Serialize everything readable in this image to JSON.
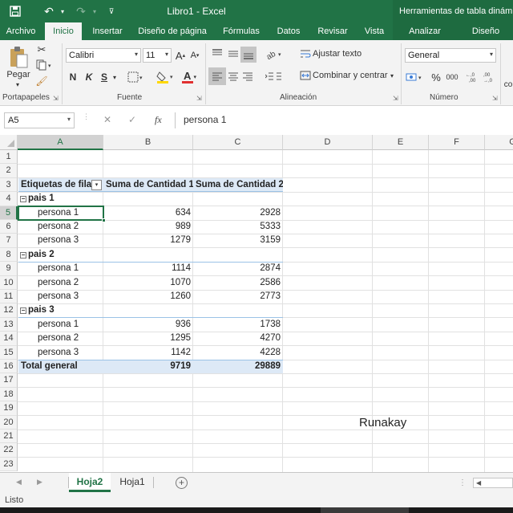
{
  "window": {
    "title": "Libro1 - Excel",
    "context_title": "Herramientas de tabla dinámica"
  },
  "tabs": [
    {
      "label": "Archivo"
    },
    {
      "label": "Inicio"
    },
    {
      "label": "Insertar"
    },
    {
      "label": "Diseño de página"
    },
    {
      "label": "Fórmulas"
    },
    {
      "label": "Datos"
    },
    {
      "label": "Revisar"
    },
    {
      "label": "Vista"
    },
    {
      "label": "Analizar"
    },
    {
      "label": "Diseño"
    }
  ],
  "ribbon": {
    "clipboard": {
      "paste_label": "Pegar",
      "group_label": "Portapapeles"
    },
    "font": {
      "name": "Calibri",
      "size": "11",
      "group_label": "Fuente",
      "bold": "N",
      "italic": "K",
      "underline": "S",
      "grow": "A",
      "shrink": "A",
      "font_color": "A",
      "font_color_hex": "#e03030",
      "fill_color_hex": "#ffd800"
    },
    "alignment": {
      "wrap_label": "Ajustar texto",
      "merge_label": "Combinar y centrar",
      "group_label": "Alineación"
    },
    "number": {
      "format": "General",
      "group_label": "Número",
      "percent": "%",
      "thousands": "000"
    },
    "cut_off_label": "co"
  },
  "formula_bar": {
    "name_box": "A5",
    "cancel": "✕",
    "enter": "✓",
    "fx": "fx",
    "value": "persona 1"
  },
  "columns": [
    "A",
    "B",
    "C",
    "D",
    "E",
    "F",
    "G"
  ],
  "rows": [
    "1",
    "2",
    "3",
    "4",
    "5",
    "6",
    "7",
    "8",
    "9",
    "10",
    "11",
    "12",
    "13",
    "14",
    "15",
    "16",
    "17",
    "18",
    "19",
    "20",
    "21",
    "22",
    "23"
  ],
  "pivot": {
    "headers": [
      "Etiquetas de fila",
      "Suma de Cantidad 1",
      "Suma de Cantidad 2"
    ],
    "groups": [
      {
        "name": "pais 1",
        "items": [
          {
            "label": "persona 1",
            "c1": "634",
            "c2": "2928"
          },
          {
            "label": "persona 2",
            "c1": "989",
            "c2": "5333"
          },
          {
            "label": "persona 3",
            "c1": "1279",
            "c2": "3159"
          }
        ]
      },
      {
        "name": "pais 2",
        "items": [
          {
            "label": "persona 1",
            "c1": "1114",
            "c2": "2874"
          },
          {
            "label": "persona 2",
            "c1": "1070",
            "c2": "2586"
          },
          {
            "label": "persona 3",
            "c1": "1260",
            "c2": "2773"
          }
        ]
      },
      {
        "name": "pais 3",
        "items": [
          {
            "label": "persona 1",
            "c1": "936",
            "c2": "1738"
          },
          {
            "label": "persona 2",
            "c1": "1295",
            "c2": "4270"
          },
          {
            "label": "persona 3",
            "c1": "1142",
            "c2": "4228"
          }
        ]
      }
    ],
    "total": {
      "label": "Total general",
      "c1": "9719",
      "c2": "29889"
    },
    "collapse_glyph": "−",
    "filter_glyph": "▾"
  },
  "annotation": "Runakay",
  "sheets": {
    "tabs": [
      {
        "label": "Hoja2"
      },
      {
        "label": "Hoja1"
      }
    ],
    "add": "+"
  },
  "status": {
    "text": "Listo"
  },
  "colors": {
    "accent": "#217346",
    "pivot_header": "#dde9f6",
    "pivot_line": "#9bc2e6"
  }
}
